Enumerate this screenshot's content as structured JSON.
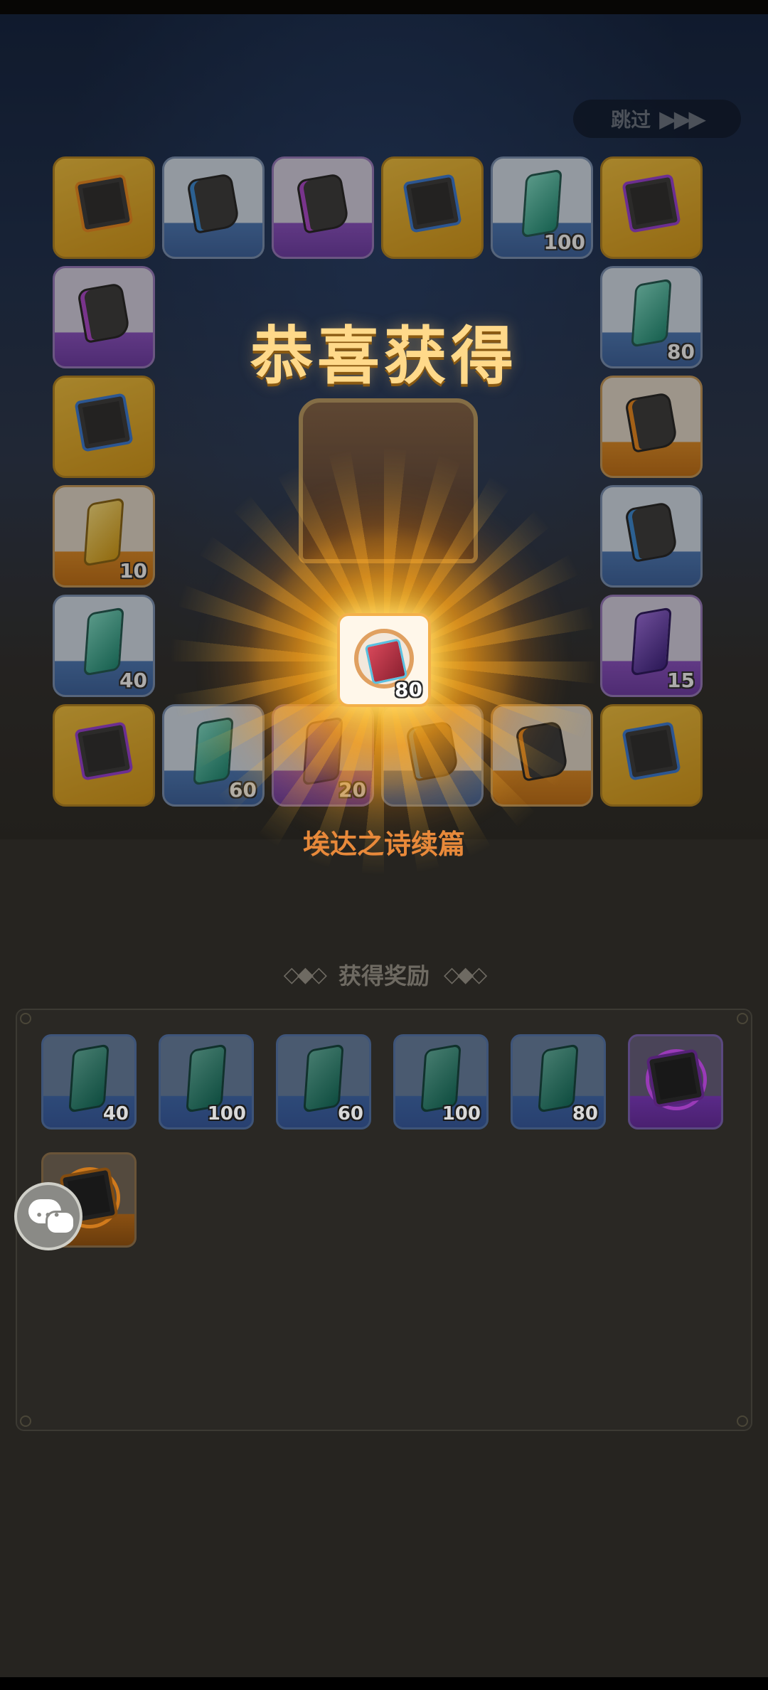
{
  "skip": {
    "label": "跳过",
    "arrows": "▶▶▶"
  },
  "title": "恭喜获得",
  "center_item": {
    "name": "埃达之诗续篇",
    "quantity": "80",
    "icon": "poem-book-icon"
  },
  "ring_tiles": [
    {
      "type": "gold",
      "icon": "cube-orange-icon",
      "qty": ""
    },
    {
      "type": "blue",
      "icon": "glove-blue-icon",
      "qty": ""
    },
    {
      "type": "purple",
      "icon": "glove-purple-icon",
      "qty": ""
    },
    {
      "type": "gold",
      "icon": "cube-blue-icon",
      "qty": ""
    },
    {
      "type": "blue",
      "icon": "crystal-teal-icon",
      "qty": "100"
    },
    {
      "type": "gold",
      "icon": "cube-purple-icon",
      "qty": ""
    },
    {
      "type": "purple",
      "icon": "glove-purple-icon",
      "qty": ""
    },
    {
      "type": "blue",
      "icon": "crystal-teal-icon",
      "qty": "80"
    },
    {
      "type": "gold",
      "icon": "cube-blue-icon",
      "qty": ""
    },
    {
      "type": "orange",
      "icon": "glove-orange-icon",
      "qty": ""
    },
    {
      "type": "orange",
      "icon": "crystal-gold-icon",
      "qty": "10"
    },
    {
      "type": "blue",
      "icon": "glove-blue-icon",
      "qty": ""
    },
    {
      "type": "blue",
      "icon": "crystal-teal-icon",
      "qty": "40"
    },
    {
      "type": "purple",
      "icon": "crystal-purple-icon",
      "qty": "15"
    },
    {
      "type": "gold",
      "icon": "cube-purple-icon",
      "qty": ""
    },
    {
      "type": "blue",
      "icon": "crystal-teal-icon",
      "qty": "60"
    },
    {
      "type": "purple",
      "icon": "crystal-purple-icon",
      "qty": "20"
    },
    {
      "type": "blue",
      "icon": "glove-blue-icon",
      "qty": ""
    },
    {
      "type": "orange",
      "icon": "glove-orange-icon",
      "qty": ""
    },
    {
      "type": "gold",
      "icon": "cube-blue-icon",
      "qty": ""
    }
  ],
  "rewards": {
    "header": "获得奖励",
    "items": [
      {
        "type": "blue",
        "icon": "crystal-teal-icon",
        "qty": "40"
      },
      {
        "type": "blue",
        "icon": "crystal-teal-icon",
        "qty": "100"
      },
      {
        "type": "blue",
        "icon": "crystal-teal-icon",
        "qty": "60"
      },
      {
        "type": "blue",
        "icon": "crystal-teal-icon",
        "qty": "100"
      },
      {
        "type": "blue",
        "icon": "crystal-teal-icon",
        "qty": "80"
      },
      {
        "type": "purple",
        "icon": "cube-purple-icon",
        "qty": ""
      },
      {
        "type": "orange",
        "icon": "cube-orange-icon",
        "qty": ""
      }
    ]
  },
  "chat_button": {
    "icon": "chat-bubble-icon"
  }
}
